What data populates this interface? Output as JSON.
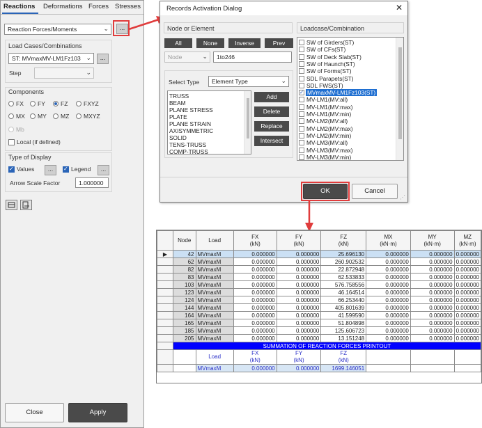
{
  "left_panel": {
    "tabs": [
      "Reactions",
      "Deformations",
      "Forces",
      "Stresses"
    ],
    "result_type": "Reaction Forces/Moments",
    "dots": "...",
    "load_cases_title": "Load Cases/Combinations",
    "load_case": "ST: MVmaxMV-LM1Fz103",
    "step_label": "Step",
    "components_title": "Components",
    "components": [
      "FX",
      "FY",
      "FZ",
      "FXYZ",
      "MX",
      "MY",
      "MZ",
      "MXYZ",
      "Mb"
    ],
    "selected_component": "FZ",
    "local_label": "Local (if defined)",
    "display_title": "Type of Display",
    "values_label": "Values",
    "legend_label": "Legend",
    "arrow_scale_label": "Arrow Scale Factor",
    "arrow_scale_value": "1.000000",
    "close_label": "Close",
    "apply_label": "Apply"
  },
  "dialog": {
    "title": "Records Activation Dialog",
    "close_glyph": "✕",
    "node_or_element": "Node or Element",
    "buttons": [
      "All",
      "None",
      "Inverse",
      "Prev"
    ],
    "node_combo": "Node",
    "node_range": "1to246",
    "select_type_label": "Select Type",
    "select_type_value": "Element Type",
    "element_types": [
      "TRUSS",
      "BEAM",
      "PLANE STRESS",
      "PLATE",
      "PLANE STRAIN",
      "AXISYMMETRIC",
      "SOLID",
      "TENS-TRUSS",
      "COMP-TRUSS"
    ],
    "action_buttons": [
      "Add",
      "Delete",
      "Replace",
      "Intersect"
    ],
    "loadcase_title": "Loadcase/Combination",
    "loadcases": [
      {
        "label": "SW of Girders(ST)",
        "checked": false
      },
      {
        "label": "SW of CFs(ST)",
        "checked": false
      },
      {
        "label": "SW of Deck Slab(ST)",
        "checked": false
      },
      {
        "label": "SW of Haunch(ST)",
        "checked": false
      },
      {
        "label": "SW of Forms(ST)",
        "checked": false
      },
      {
        "label": "SDL Parapets(ST)",
        "checked": false
      },
      {
        "label": "SDL FWS(ST)",
        "checked": false
      },
      {
        "label": "MVmaxMV-LM1Fz103(ST)",
        "checked": true
      },
      {
        "label": "MV-LM1(MV:all)",
        "checked": false
      },
      {
        "label": "MV-LM1(MV:max)",
        "checked": false
      },
      {
        "label": "MV-LM1(MV:min)",
        "checked": false
      },
      {
        "label": "MV-LM2(MV:all)",
        "checked": false
      },
      {
        "label": "MV-LM2(MV:max)",
        "checked": false
      },
      {
        "label": "MV-LM2(MV:min)",
        "checked": false
      },
      {
        "label": "MV-LM3(MV:all)",
        "checked": false
      },
      {
        "label": "MV-LM3(MV:max)",
        "checked": false
      },
      {
        "label": "MV-LM3(MV:min)",
        "checked": false
      }
    ],
    "ok_label": "OK",
    "cancel_label": "Cancel"
  },
  "table": {
    "headers": [
      "Node",
      "Load",
      "FX\n(kN)",
      "FY\n(kN)",
      "FZ\n(kN)",
      "MX\n(kN·m)",
      "MY\n(kN·m)",
      "MZ\n(kN·m)"
    ],
    "rows": [
      [
        "42",
        "MVmaxM",
        "0.000000",
        "0.000000",
        "25.696130",
        "0.000000",
        "0.000000",
        "0.000000"
      ],
      [
        "62",
        "MVmaxM",
        "0.000000",
        "0.000000",
        "260.902532",
        "0.000000",
        "0.000000",
        "0.000000"
      ],
      [
        "82",
        "MVmaxM",
        "0.000000",
        "0.000000",
        "22.872948",
        "0.000000",
        "0.000000",
        "0.000000"
      ],
      [
        "83",
        "MVmaxM",
        "0.000000",
        "0.000000",
        "62.533833",
        "0.000000",
        "0.000000",
        "0.000000"
      ],
      [
        "103",
        "MVmaxM",
        "0.000000",
        "0.000000",
        "576.758556",
        "0.000000",
        "0.000000",
        "0.000000"
      ],
      [
        "123",
        "MVmaxM",
        "0.000000",
        "0.000000",
        "46.164514",
        "0.000000",
        "0.000000",
        "0.000000"
      ],
      [
        "124",
        "MVmaxM",
        "0.000000",
        "0.000000",
        "66.253440",
        "0.000000",
        "0.000000",
        "0.000000"
      ],
      [
        "144",
        "MVmaxM",
        "0.000000",
        "0.000000",
        "405.801639",
        "0.000000",
        "0.000000",
        "0.000000"
      ],
      [
        "164",
        "MVmaxM",
        "0.000000",
        "0.000000",
        "41.599590",
        "0.000000",
        "0.000000",
        "0.000000"
      ],
      [
        "165",
        "MVmaxM",
        "0.000000",
        "0.000000",
        "51.804898",
        "0.000000",
        "0.000000",
        "0.000000"
      ],
      [
        "185",
        "MVmaxM",
        "0.000000",
        "0.000000",
        "125.606723",
        "0.000000",
        "0.000000",
        "0.000000"
      ],
      [
        "205",
        "MVmaxM",
        "0.000000",
        "0.000000",
        "13.151248",
        "0.000000",
        "0.000000",
        "0.000000"
      ]
    ],
    "summation_title": "SUMMATION OF REACTION FORCES PRINTOUT",
    "sum_headers": [
      "Load",
      "FX\n(kN)",
      "FY\n(kN)",
      "FZ\n(kN)"
    ],
    "sum_row": [
      "MVmaxM",
      "0.000000",
      "0.000000",
      "1699.146051"
    ],
    "current_row_marker": "▶"
  },
  "colors": {
    "accent_red": "#e03c3c",
    "selection_blue": "#1f6fd1",
    "banner_blue": "#0000ff"
  }
}
